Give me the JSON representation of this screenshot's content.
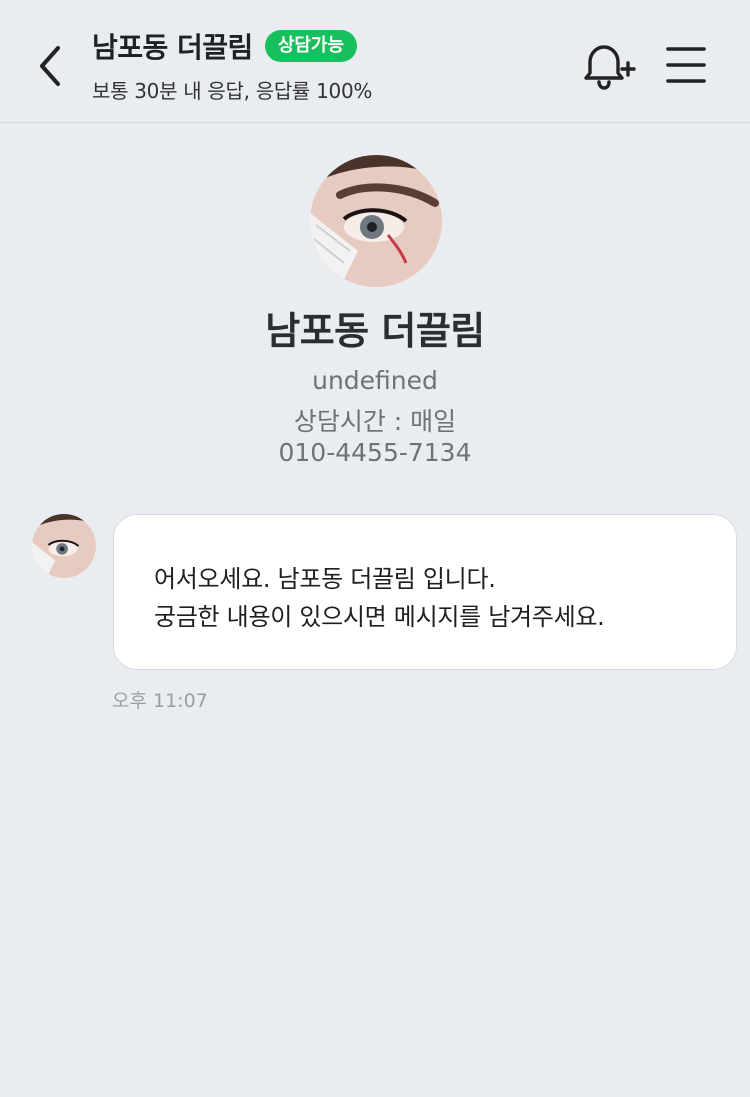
{
  "header": {
    "title": "남포동 더끌림",
    "status_badge": "상담가능",
    "subtitle": "보통 30분 내 응답, 응답률 100%",
    "back_icon": "chevron-left-icon",
    "notification_icon": "bell-plus-icon",
    "menu_icon": "hamburger-menu-icon",
    "badge_color": "#15c05d"
  },
  "profile": {
    "name": "남포동 더끌림",
    "description": "undefined",
    "hours": "상담시간 : 매일",
    "phone": "010-4455-7134"
  },
  "messages": [
    {
      "lines": [
        "어서오세요. 남포동 더끌림 입니다.",
        "궁금한 내용이 있으시면 메시지를 남겨주세요."
      ],
      "time": "오후 11:07"
    }
  ]
}
